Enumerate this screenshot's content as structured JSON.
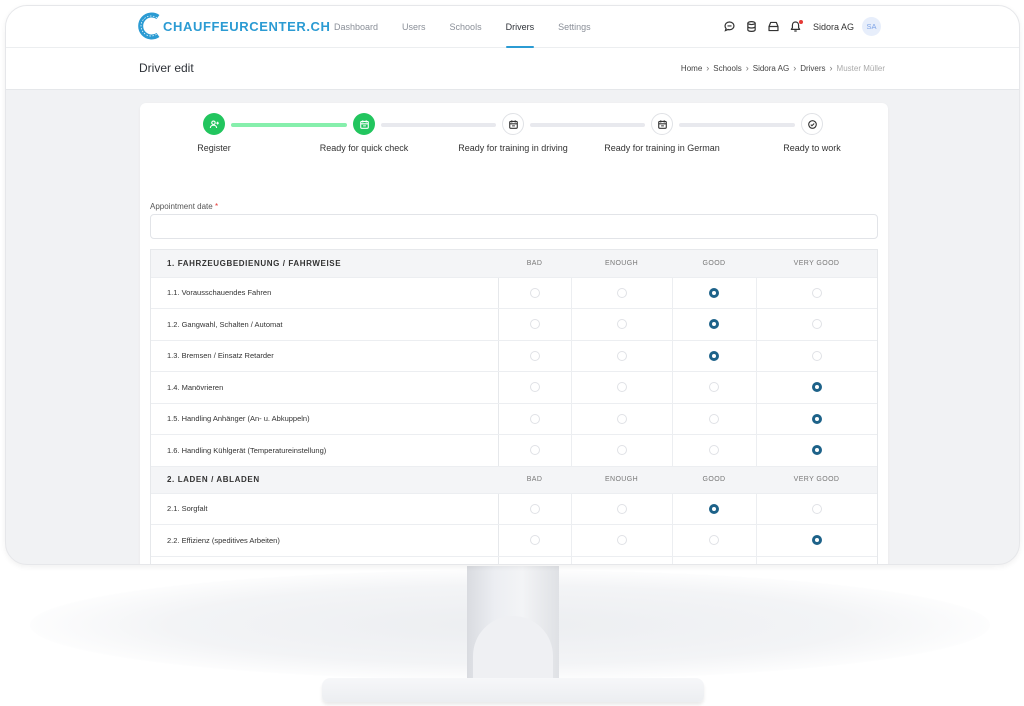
{
  "app": {
    "brand": "CHAUFFEURCENTER.CH",
    "brand_color": "#2b9bd3",
    "nav": [
      {
        "label": "Dashboard",
        "active": false
      },
      {
        "label": "Users",
        "active": false
      },
      {
        "label": "Schools",
        "active": false
      },
      {
        "label": "Drivers",
        "active": true
      },
      {
        "label": "Settings",
        "active": false
      }
    ],
    "top_icons": [
      "chat-icon",
      "database-icon",
      "inbox-icon",
      "bell-icon"
    ],
    "notification_dot": true,
    "user": {
      "name": "Sidora AG",
      "initials": "SA"
    }
  },
  "header": {
    "title": "Driver edit",
    "breadcrumb": [
      "Home",
      "Schools",
      "Sidora AG",
      "Drivers",
      "Muster Müller"
    ]
  },
  "stepper": {
    "steps": [
      {
        "label": "Register",
        "icon": "user-plus-icon",
        "status": "done"
      },
      {
        "label": "Ready for quick check",
        "icon": "calendar-icon",
        "status": "done"
      },
      {
        "label": "Ready for training in driving",
        "icon": "calendar-icon",
        "status": "pending"
      },
      {
        "label": "Ready for training in German",
        "icon": "calendar-icon",
        "status": "pending"
      },
      {
        "label": "Ready to work",
        "icon": "check-circle-icon",
        "status": "pending"
      }
    ],
    "done_color": "#22c55e",
    "line_done_color": "#86efac"
  },
  "form": {
    "appointment_label": "Appointment date",
    "required_mark": "*",
    "appointment_value": ""
  },
  "evaluation": {
    "columns": [
      "BAD",
      "ENOUGH",
      "GOOD",
      "VERY GOOD"
    ],
    "selected_color": "#1d6289",
    "sections": [
      {
        "title": "1. FAHRZEUGBEDIENUNG / FAHRWEISE",
        "items": [
          {
            "label": "1.1. Vorausschauendes Fahren",
            "selected": "GOOD"
          },
          {
            "label": "1.2. Gangwahl, Schalten / Automat",
            "selected": "GOOD"
          },
          {
            "label": "1.3. Bremsen / Einsatz Retarder",
            "selected": "GOOD"
          },
          {
            "label": "1.4. Manövrieren",
            "selected": "VERY GOOD"
          },
          {
            "label": "1.5. Handling Anhänger (An- u. Abkuppeln)",
            "selected": "VERY GOOD"
          },
          {
            "label": "1.6. Handling Kühlgerät (Temperatureinstellung)",
            "selected": "VERY GOOD"
          }
        ]
      },
      {
        "title": "2. LADEN / ABLADEN",
        "items": [
          {
            "label": "2.1. Sorgfalt",
            "selected": "GOOD"
          },
          {
            "label": "2.2. Effizienz (speditives Arbeiten)",
            "selected": "VERY GOOD"
          },
          {
            "label": "",
            "selected": ""
          }
        ]
      }
    ]
  }
}
